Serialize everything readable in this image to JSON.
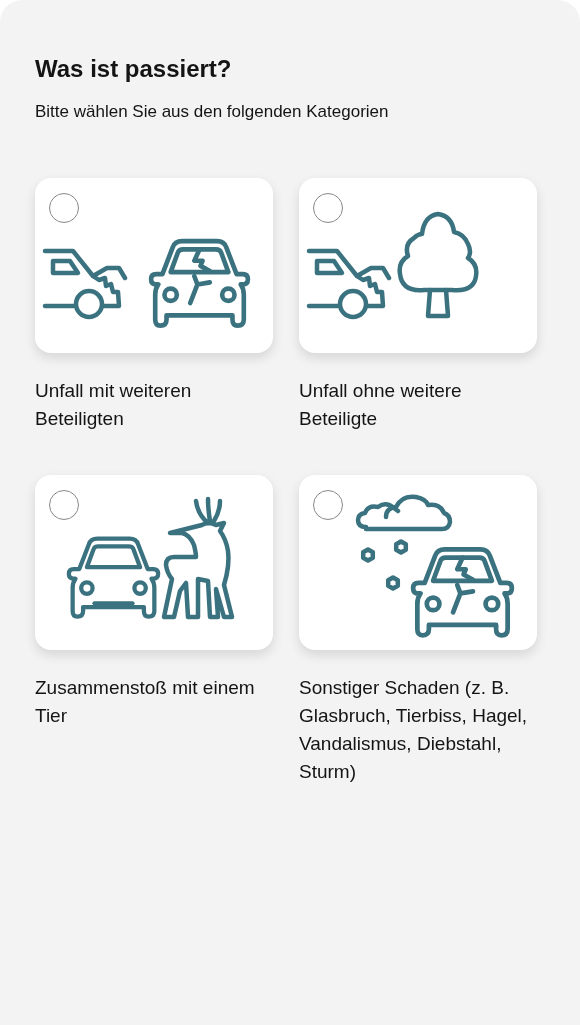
{
  "title": "Was ist passiert?",
  "subtitle": "Bitte wählen Sie aus den folgenden Kategorien",
  "options": [
    {
      "kind": "collision",
      "label": "Unfall mit weiteren Beteiligten",
      "selected": false
    },
    {
      "kind": "single",
      "label": "Unfall ohne weitere Beteiligte",
      "selected": false
    },
    {
      "kind": "animal",
      "label": "Zusammenstoß mit einem Tier",
      "selected": false
    },
    {
      "kind": "other",
      "label": "Sonstiger Schaden (z. B. Glasbruch, Tierbiss, Hagel, Vandalismus, Diebstahl, Sturm)",
      "selected": false
    }
  ]
}
